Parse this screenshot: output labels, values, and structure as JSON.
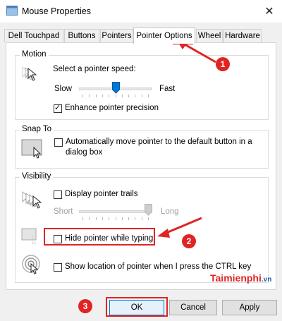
{
  "window": {
    "title": "Mouse Properties",
    "close_glyph": "✕"
  },
  "tabs": [
    {
      "label": "Dell Touchpad"
    },
    {
      "label": "Buttons"
    },
    {
      "label": "Pointers"
    },
    {
      "label": "Pointer Options",
      "active": true
    },
    {
      "label": "Wheel"
    },
    {
      "label": "Hardware"
    }
  ],
  "motion": {
    "group_title": "Motion",
    "speed_label": "Select a pointer speed:",
    "slow_label": "Slow",
    "fast_label": "Fast",
    "speed_fraction": 0.5,
    "enhance_label": "Enhance pointer precision",
    "enhance_checked": true
  },
  "snap_to": {
    "group_title": "Snap To",
    "line1": "Automatically move pointer to the default button in a",
    "line2": "dialog box",
    "checked": false
  },
  "visibility": {
    "group_title": "Visibility",
    "trails_label": "Display pointer trails",
    "trails_checked": false,
    "short_label": "Short",
    "long_label": "Long",
    "trail_fraction": 1.0,
    "hide_label": "Hide pointer while typing",
    "hide_checked": false,
    "show_location_label": "Show location of pointer when I press the CTRL key",
    "show_location_checked": false
  },
  "buttons": {
    "ok": "OK",
    "cancel": "Cancel",
    "apply": "Apply"
  },
  "annotations": {
    "badge1": "1",
    "badge2": "2",
    "badge3": "3",
    "accent": "#e02424"
  },
  "watermark": {
    "brand": "Taimienphi",
    "brand_suffix": ".vn"
  }
}
